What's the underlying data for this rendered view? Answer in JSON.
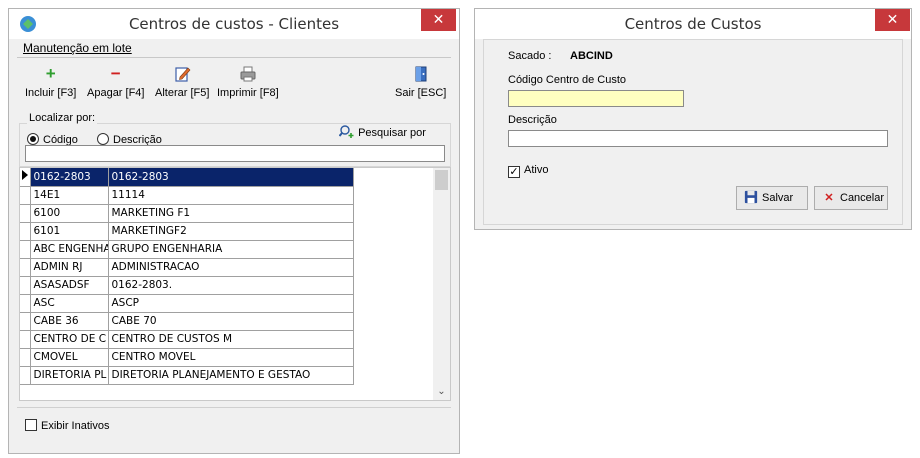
{
  "win1": {
    "title": "Centros de custos - Clientes",
    "close_glyph": "✕",
    "menu": "Manutenção em lote",
    "toolbar": {
      "incluir": "Incluir [F3]",
      "apagar": "Apagar [F4]",
      "alterar": "Alterar [F5]",
      "imprimir": "Imprimir [F8]",
      "sair": "Sair [ESC]",
      "icons": {
        "incluir": "plus-icon",
        "apagar": "minus-icon",
        "alterar": "edit-icon",
        "imprimir": "printer-icon",
        "sair": "exit-door-icon"
      }
    },
    "search": {
      "group_label": "Localizar por:",
      "radio_codigo": "Código",
      "radio_descricao": "Descrição",
      "selected": "Código",
      "pesquisar": "Pesquisar por",
      "value": ""
    },
    "grid": {
      "selected_row": 0,
      "rows": [
        {
          "codigo": "0162-2803",
          "descricao": "0162-2803"
        },
        {
          "codigo": "14E1",
          "descricao": "11114"
        },
        {
          "codigo": "6100",
          "descricao": "MARKETING F1"
        },
        {
          "codigo": "6101",
          "descricao": "MARKETINGF2"
        },
        {
          "codigo": "ABC ENGENHA",
          "descricao": "GRUPO ENGENHARIA"
        },
        {
          "codigo": "ADMIN RJ",
          "descricao": "ADMINISTRACAO"
        },
        {
          "codigo": "ASASADSF",
          "descricao": "0162-2803."
        },
        {
          "codigo": "ASC",
          "descricao": "ASCP"
        },
        {
          "codigo": "CABE 36",
          "descricao": "CABE 70"
        },
        {
          "codigo": "CENTRO DE C",
          "descricao": "CENTRO DE CUSTOS M"
        },
        {
          "codigo": "CMOVEL",
          "descricao": "CENTRO MOVEL"
        },
        {
          "codigo": "DIRETORIA PL",
          "descricao": "DIRETORIA PLANEJAMENTO E GESTAO"
        }
      ]
    },
    "exibir_inativos": {
      "label": "Exibir Inativos",
      "checked": false
    }
  },
  "win2": {
    "title": "Centros de Custos",
    "close_glyph": "✕",
    "sacado_label": "Sacado :",
    "sacado_value": "ABCIND",
    "codigo_label": "Código Centro de Custo",
    "codigo_value": "",
    "descricao_label": "Descrição",
    "descricao_value": "",
    "ativo_label": "Ativo",
    "ativo_checked": true,
    "check_glyph": "✓",
    "salvar": "Salvar",
    "cancelar": "Cancelar"
  },
  "colors": {
    "selection": "#0a246a",
    "close": "#c7383b",
    "field_highlight": "#ffffc0"
  }
}
